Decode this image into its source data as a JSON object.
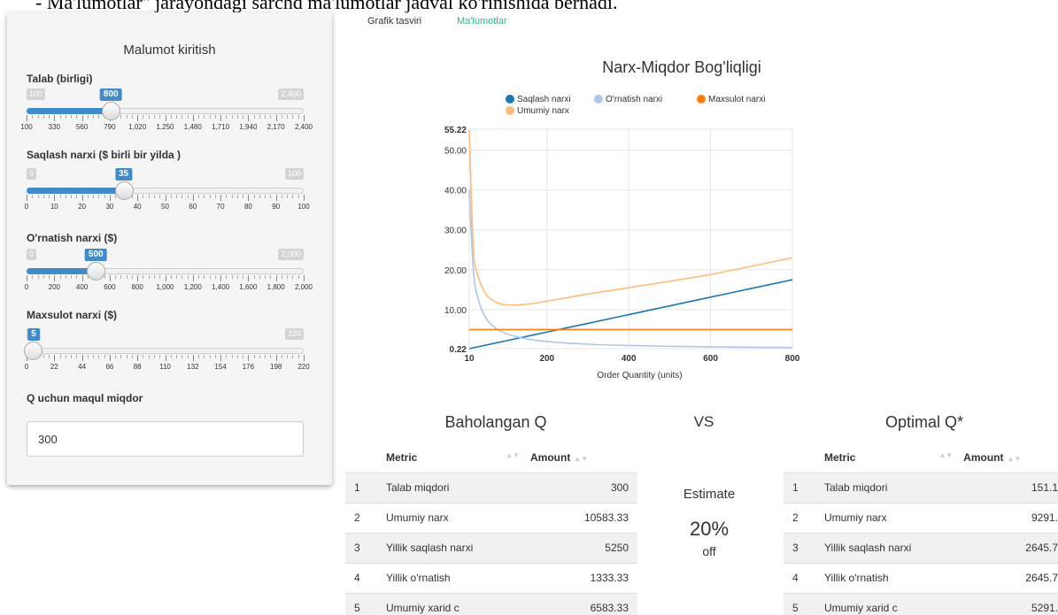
{
  "caption": "- Ma'lumotlar\" jarayondagi sarchd ma'lumotlar jadval ko'rinishida bernadi.",
  "sidebar": {
    "title": "Malumot kiritish",
    "sliders": [
      {
        "label": "Talab (birligi)",
        "min": 100,
        "max": 2400,
        "value": 800,
        "ticks": [
          "100",
          "330",
          "560",
          "790",
          "1,020",
          "1,250",
          "1,480",
          "1,710",
          "1,940",
          "2,170",
          "2,400"
        ]
      },
      {
        "label": "Saqlash narxi ($ birli bir yilda )",
        "min": 0,
        "max": 100,
        "value": 35,
        "ticks": [
          "0",
          "10",
          "20",
          "30",
          "40",
          "50",
          "60",
          "70",
          "80",
          "90",
          "100"
        ]
      },
      {
        "label": "O'rnatish narxi ($)",
        "min": 0,
        "max": 2000,
        "value": 500,
        "ticks": [
          "0",
          "200",
          "400",
          "600",
          "800",
          "1,000",
          "1,200",
          "1,400",
          "1,600",
          "1,800",
          "2,000"
        ]
      },
      {
        "label": "Maxsulot narxi ($)",
        "min": 0,
        "max": 220,
        "value": 5,
        "ticks": [
          "0",
          "22",
          "44",
          "66",
          "88",
          "110",
          "132",
          "154",
          "176",
          "198",
          "220"
        ]
      }
    ],
    "q_label": "Q uchun maqul miqdor",
    "q_value": "300"
  },
  "tabs": [
    {
      "label": "Grafik tasviri",
      "active": false
    },
    {
      "label": "Ma'lumotlar",
      "active": true
    }
  ],
  "chart_data": {
    "type": "line",
    "title": "Narx-Miqdor Bog'liqligi",
    "xlabel": "Order Quantity (units)",
    "ylabel": "",
    "xlim": [
      10,
      800
    ],
    "ylim": [
      0.22,
      55.22
    ],
    "x_ticks": [
      10,
      200,
      400,
      600,
      800
    ],
    "y_ticks": [
      0.22,
      10,
      20,
      30,
      40,
      50,
      55.22
    ],
    "y_tick_labels": [
      "0.22",
      "10.00",
      "20.00",
      "30.00",
      "40.00",
      "50.00",
      "55.22"
    ],
    "grid": true,
    "legend_position": "top",
    "series": [
      {
        "name": "Saqlash narxi",
        "color": "#1f77b4",
        "x": [
          10,
          100,
          200,
          300,
          400,
          500,
          600,
          700,
          800
        ],
        "y": [
          0.22,
          2.19,
          4.38,
          6.56,
          8.75,
          10.94,
          13.13,
          15.31,
          17.5
        ]
      },
      {
        "name": "O'rnatish narxi",
        "color": "#aec7e8",
        "x": [
          10,
          20,
          30,
          50,
          75,
          100,
          150,
          200,
          300,
          400,
          500,
          600,
          700,
          800
        ],
        "y": [
          40,
          20,
          13.33,
          8,
          5.33,
          4,
          2.67,
          2,
          1.33,
          1,
          0.8,
          0.67,
          0.57,
          0.5
        ]
      },
      {
        "name": "Maxsulot narxi",
        "color": "#ff7f0e",
        "x": [
          10,
          800
        ],
        "y": [
          5,
          5
        ]
      },
      {
        "name": "Umumiy narx",
        "color": "#ffbb78",
        "x": [
          10,
          20,
          30,
          50,
          75,
          100,
          150,
          200,
          300,
          400,
          500,
          600,
          700,
          800
        ],
        "y": [
          55,
          25.5,
          19,
          14,
          11.9,
          11.2,
          11.35,
          12.1,
          13.9,
          15.5,
          17.1,
          18.8,
          20.9,
          23
        ]
      }
    ]
  },
  "estimated": {
    "title": "Baholangan Q",
    "headers": [
      "",
      "Metric",
      "Amount"
    ],
    "rows": [
      [
        "1",
        "Talab miqdori",
        "300"
      ],
      [
        "2",
        "Umumiy narx",
        "10583.33"
      ],
      [
        "3",
        "Yillik saqlash narxi",
        "5250"
      ],
      [
        "4",
        "Yillik o'rnatish",
        "1333.33"
      ],
      [
        "5",
        "Umumiy xarid c",
        "6583.33"
      ]
    ]
  },
  "vs_label": "VS",
  "discount": {
    "label": "Estimate",
    "value": "20%",
    "suffix": "off"
  },
  "optimal": {
    "title": "Optimal Q*",
    "headers": [
      "",
      "Metric",
      "Amount"
    ],
    "rows": [
      [
        "1",
        "Talab miqdori",
        "151.1"
      ],
      [
        "2",
        "Umumiy narx",
        "9291."
      ],
      [
        "3",
        "Yillik saqlash narxi",
        "2645.7"
      ],
      [
        "4",
        "Yillik o'rnatish",
        "2645.7"
      ],
      [
        "5",
        "Umumiy xarid c",
        "5291."
      ]
    ]
  }
}
